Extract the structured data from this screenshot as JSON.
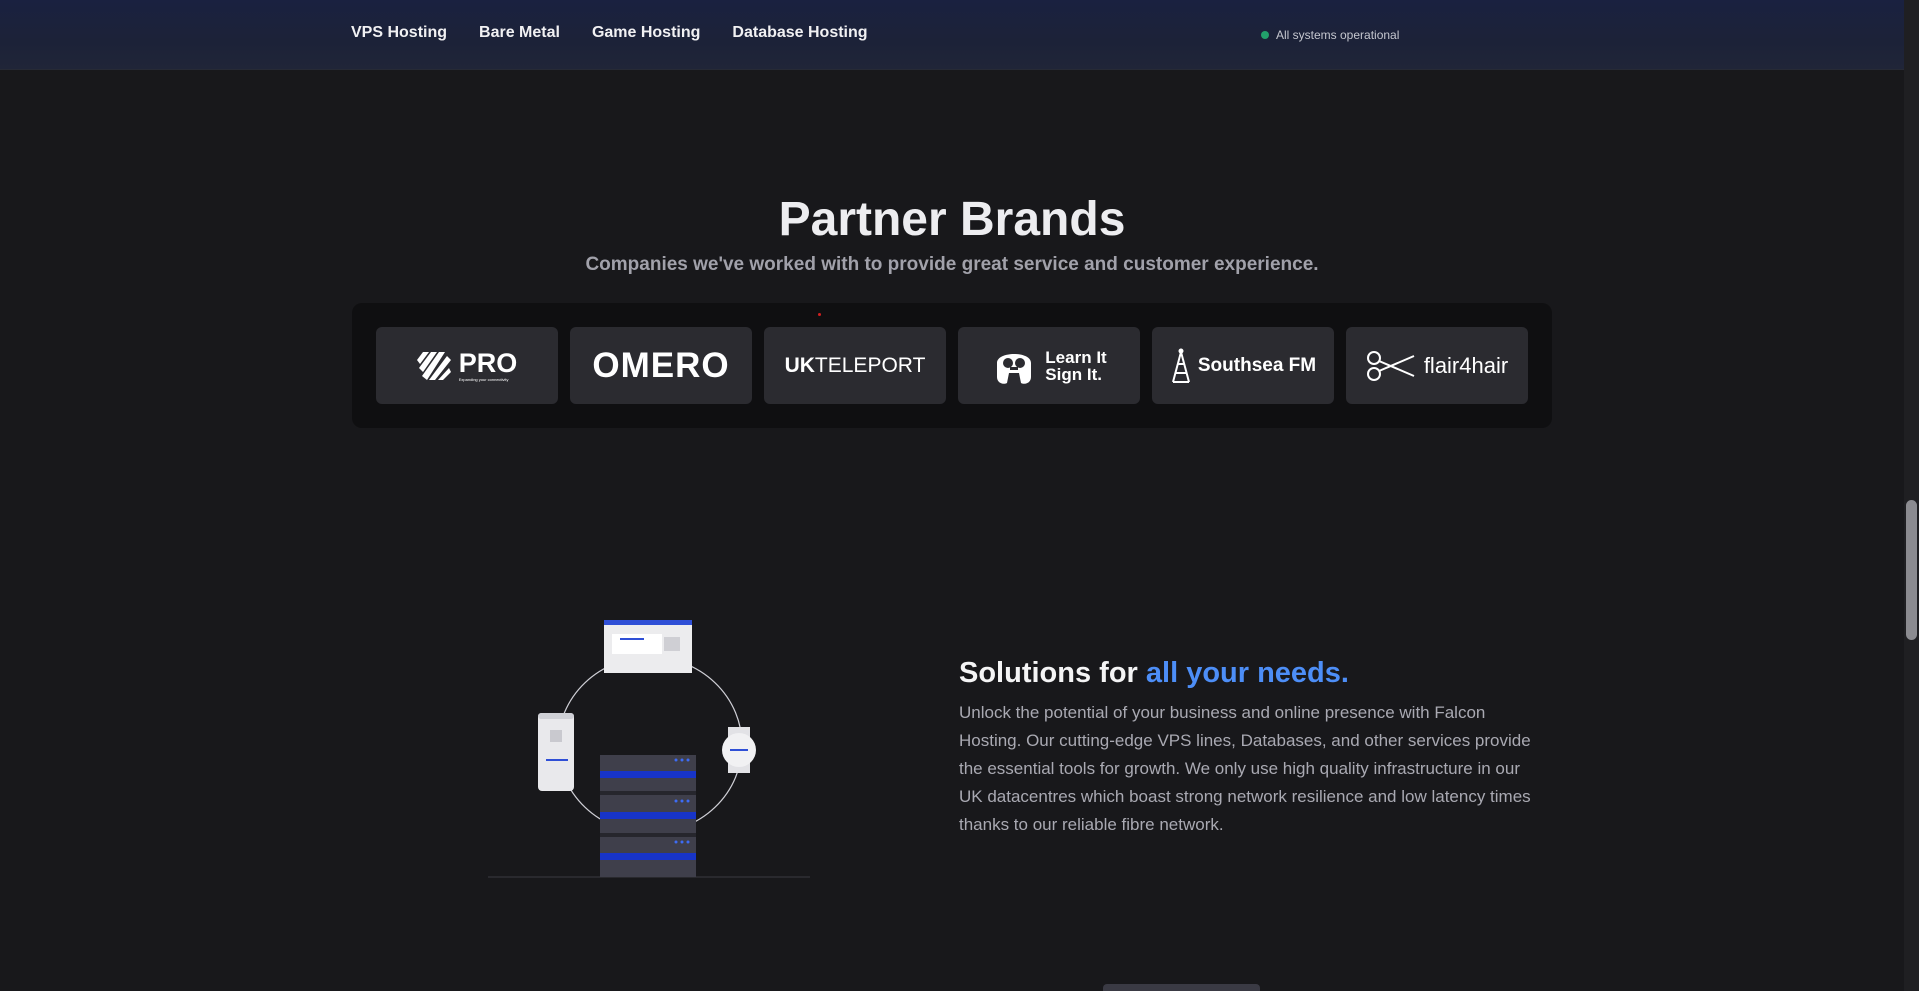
{
  "nav": {
    "links": [
      "VPS Hosting",
      "Bare Metal",
      "Game Hosting",
      "Database Hosting"
    ],
    "status_text": "All systems operational",
    "status_color": "#22a06b"
  },
  "partners": {
    "title": "Partner Brands",
    "subtitle": "Companies we've worked with to provide great service and customer experience.",
    "brands": [
      {
        "name": "PRO",
        "tagline": "Expanding your connectivity",
        "icon": "stripes-logo-icon"
      },
      {
        "name": "OMERO",
        "icon": "omero-wordmark"
      },
      {
        "name": "UK",
        "name2": "TELEPORT",
        "icon": "ukteleport-wordmark"
      },
      {
        "name": "Learn It",
        "name2": "Sign It.",
        "icon": "signing-hands-icon"
      },
      {
        "name": "Southsea FM",
        "icon": "radio-tower-icon"
      },
      {
        "name": "flair4hair",
        "icon": "scissors-icon"
      }
    ]
  },
  "solutions": {
    "heading_prefix": "Solutions for",
    "heading_accent": "all your needs.",
    "accent_color": "#4d8ef7",
    "body": "Unlock the potential of your business and online presence with Falcon Hosting. Our cutting-edge VPS lines, Databases, and other services provide the essential tools for growth. We only use high quality infrastructure in our UK datacentres which boast strong network resilience and low latency times thanks to our reliable fibre network."
  }
}
